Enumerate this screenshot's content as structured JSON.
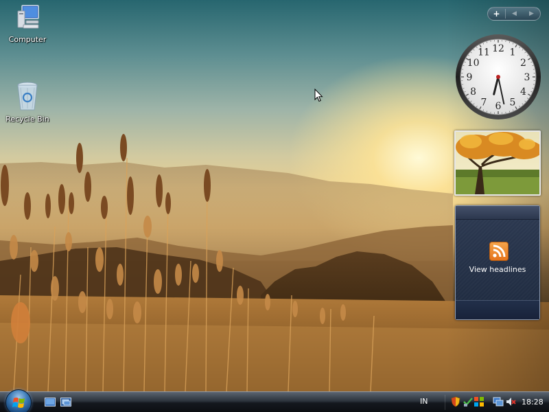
{
  "desktop": {
    "icons": [
      {
        "label": "Computer",
        "icon": "computer-icon"
      },
      {
        "label": "Recycle Bin",
        "icon": "recycle-bin-icon"
      }
    ]
  },
  "sidebar": {
    "controls": {
      "add_label": "+",
      "prev_label": "◀",
      "next_label": "▶"
    },
    "clock": {
      "numerals": [
        "12",
        "1",
        "2",
        "3",
        "4",
        "5",
        "6",
        "7",
        "8",
        "9",
        "10",
        "11"
      ],
      "hour": 18,
      "minute": 28
    },
    "feed": {
      "label": "View headlines",
      "icon": "rss-icon",
      "accent": "#e5741b"
    }
  },
  "taskbar": {
    "start_icon": "windows-start-orb-icon",
    "quick_launch": [
      "show-desktop-icon",
      "switch-windows-icon"
    ],
    "language": "IN",
    "tray_icons": [
      "security-shield-icon",
      "network-icon",
      "windows-update-icon",
      "network-connection-icon",
      "volume-muted-icon"
    ],
    "clock": "18:28"
  },
  "colors": {
    "taskbar_dark": "#0c0e12",
    "feed_background": "#1e2a3f",
    "sky_top": "#27666f",
    "sun_glow": "#fff4d0"
  }
}
